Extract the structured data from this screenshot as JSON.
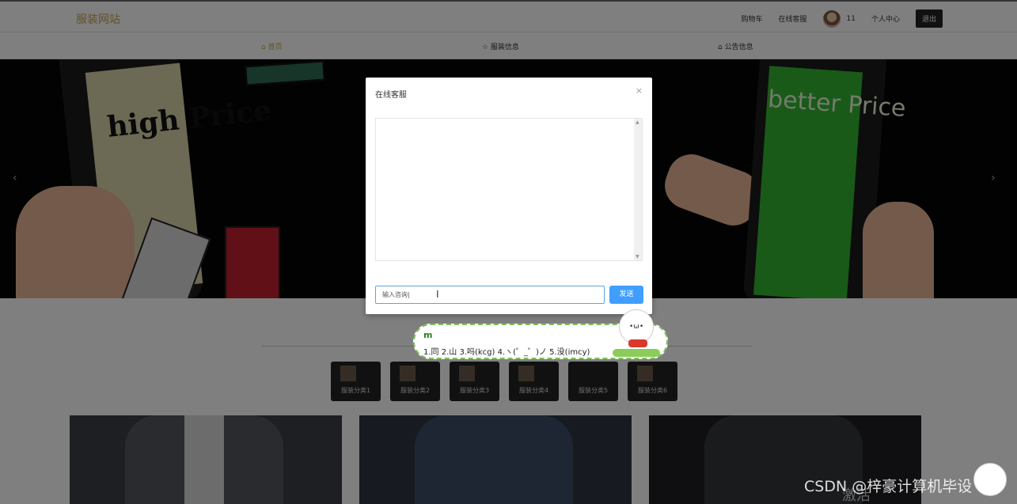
{
  "header": {
    "logo": "服装网站",
    "cart": "购物车",
    "service": "在线客服",
    "user_id": "11",
    "profile": "个人中心",
    "logout": "退出"
  },
  "nav": {
    "home": "⌂ 首页",
    "clothing": "☆ 服装信息",
    "notice": "⌂ 公告信息"
  },
  "banner": {
    "left_text": "high Price",
    "right_text": "better Price",
    "prev": "‹",
    "next": "›"
  },
  "categories": [
    {
      "label": "服装分类1"
    },
    {
      "label": "服装分类2"
    },
    {
      "label": "服装分类3"
    },
    {
      "label": "服装分类4"
    },
    {
      "label": "服装分类5"
    },
    {
      "label": "服装分类6"
    }
  ],
  "modal": {
    "title": "在线客服",
    "close": "×",
    "input_value": "输入咨询|",
    "send": "发送"
  },
  "ime": {
    "composition": "m",
    "candidates": "1.同  2.山  3.吗(kcg)  4.ヽ(゜_゜)ノ  5.没(imcy)"
  },
  "watermark": {
    "text": "CSDN @梓豪计算机毕设",
    "activate": "激活"
  },
  "colors": {
    "accent": "#c9a14a",
    "send_button": "#409eff"
  }
}
